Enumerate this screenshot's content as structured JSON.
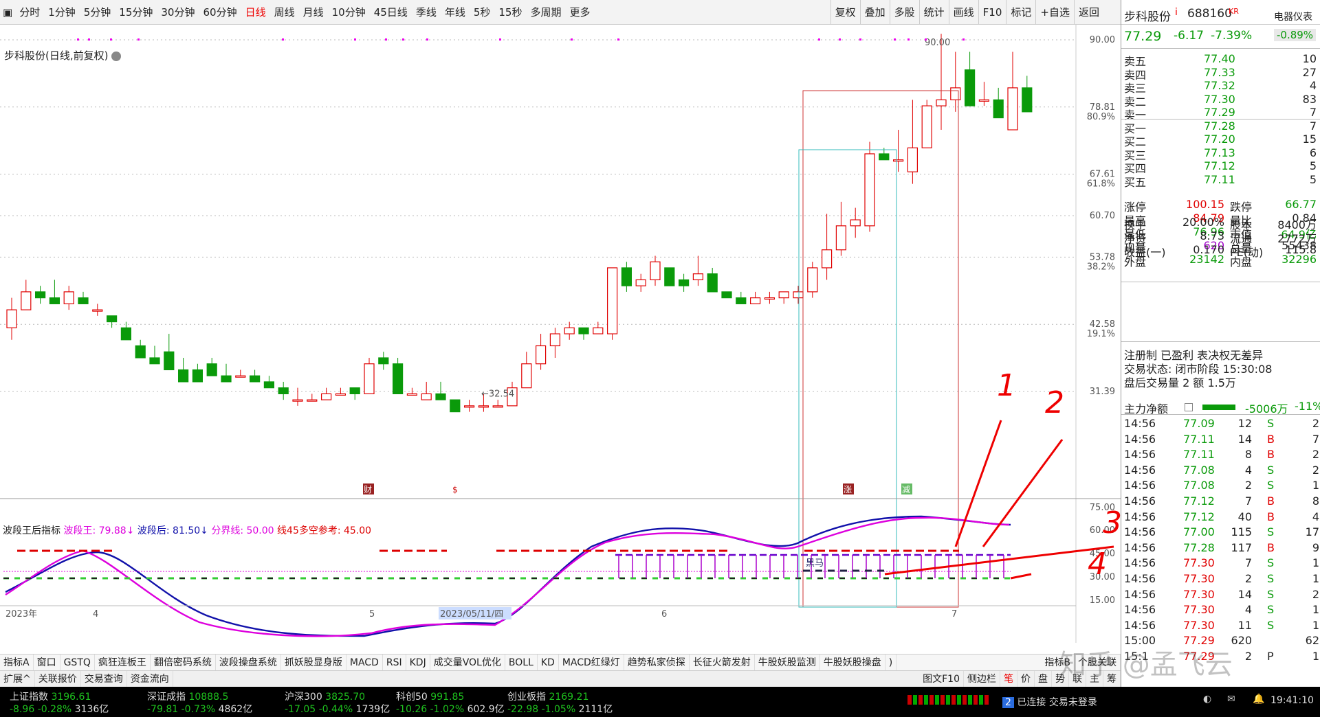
{
  "toolbar": {
    "left": [
      "分时",
      "1分钟",
      "5分钟",
      "15分钟",
      "30分钟",
      "60分钟",
      "日线",
      "周线",
      "月线",
      "10分钟",
      "45日线",
      "季线",
      "年线",
      "5秒",
      "15秒",
      "多周期",
      "更多"
    ],
    "active": "日线",
    "right": [
      "复权",
      "叠加",
      "多股",
      "统计",
      "画线",
      "F10",
      "标记",
      "+自选",
      "返回"
    ]
  },
  "chart": {
    "subtitle": "步科股份(日线,前复权)",
    "high_label": "90.00",
    "low_label": "32.54",
    "y_labels": [
      "90.00",
      "78.81",
      "80.9%",
      "67.61",
      "61.8%",
      "60.70",
      "53.78",
      "38.2%",
      "42.58",
      "19.1%",
      "31.39"
    ],
    "event_badges": [
      "财",
      "$",
      "涨",
      "减"
    ],
    "x_labels": [
      "2023年",
      "4",
      "5",
      "2023/05/11/四",
      "6",
      "7"
    ]
  },
  "chart_data": {
    "type": "candlestick",
    "ohlc": [
      [
        42,
        47,
        40,
        45
      ],
      [
        45,
        50,
        45,
        48
      ],
      [
        48,
        49,
        46,
        47
      ],
      [
        47,
        50,
        46,
        46
      ],
      [
        46,
        49,
        45,
        48
      ],
      [
        47,
        48,
        46,
        46
      ],
      [
        45,
        46,
        44,
        45
      ],
      [
        44,
        44,
        42,
        43
      ],
      [
        42,
        43,
        40,
        40
      ],
      [
        39,
        40,
        37,
        37
      ],
      [
        37,
        39,
        36,
        36
      ],
      [
        38,
        41,
        35,
        35
      ],
      [
        35,
        37,
        33,
        33
      ],
      [
        35,
        36,
        34,
        33
      ],
      [
        36,
        37,
        34,
        34
      ],
      [
        34,
        36,
        33,
        33
      ],
      [
        34,
        35,
        34,
        34
      ],
      [
        34,
        35,
        33,
        33
      ],
      [
        33,
        34,
        32,
        32
      ],
      [
        32,
        33,
        30,
        31
      ],
      [
        30,
        32,
        29,
        30
      ],
      [
        30,
        31,
        30,
        30
      ],
      [
        30,
        32,
        30,
        31
      ],
      [
        31,
        32,
        31,
        31
      ],
      [
        32,
        32,
        30,
        31
      ],
      [
        31,
        37,
        31,
        36
      ],
      [
        37,
        38,
        35,
        36
      ],
      [
        36,
        37,
        31,
        31
      ],
      [
        31,
        32,
        31,
        31
      ],
      [
        30,
        33,
        30,
        31
      ],
      [
        31,
        33,
        30,
        30
      ],
      [
        30,
        30,
        29,
        28
      ],
      [
        29,
        30,
        28,
        29
      ],
      [
        29,
        31,
        28,
        29
      ],
      [
        29,
        30,
        29,
        29
      ],
      [
        29,
        33,
        29,
        32
      ],
      [
        32,
        38,
        32,
        36
      ],
      [
        36,
        41,
        35,
        39
      ],
      [
        39,
        42,
        37,
        41
      ],
      [
        41,
        43,
        40,
        42
      ],
      [
        42,
        42,
        40,
        41
      ],
      [
        41,
        43,
        41,
        42
      ],
      [
        41,
        52,
        40,
        52
      ],
      [
        52,
        53,
        48,
        49
      ],
      [
        49,
        51,
        48,
        50
      ],
      [
        50,
        54,
        49,
        53
      ],
      [
        52,
        52,
        49,
        49
      ],
      [
        50,
        51,
        48,
        49
      ],
      [
        50,
        54,
        49,
        51
      ],
      [
        51,
        52,
        48,
        48
      ],
      [
        48,
        48,
        47,
        47
      ],
      [
        47,
        48,
        46,
        46
      ],
      [
        46,
        48,
        46,
        47
      ],
      [
        47,
        48,
        46,
        47
      ],
      [
        47,
        48,
        46,
        48
      ],
      [
        47,
        49,
        46,
        48
      ],
      [
        48,
        53,
        47,
        52
      ],
      [
        52,
        61,
        50,
        55
      ],
      [
        55,
        63,
        54,
        59
      ],
      [
        59,
        62,
        57,
        60
      ],
      [
        59,
        73,
        58,
        71
      ],
      [
        71,
        72,
        70,
        70
      ],
      [
        70,
        75,
        68,
        70
      ],
      [
        68,
        80,
        66,
        72
      ],
      [
        72,
        80,
        72,
        79
      ],
      [
        79,
        91,
        75,
        80
      ],
      [
        80,
        88,
        78,
        82
      ],
      [
        85,
        88,
        79,
        79
      ],
      [
        80,
        83,
        79,
        80
      ],
      [
        80,
        82,
        78,
        77
      ],
      [
        75,
        88,
        75,
        82
      ],
      [
        82,
        84,
        79,
        78
      ]
    ],
    "up_color": "#e00000",
    "down_color": "#0a9a0a"
  },
  "indicator": {
    "title": "波段王后指标",
    "l1": "波段王: 79.88",
    "l1d": "↓",
    "l2": "波段后: 81.50",
    "l2d": "↓",
    "l3": "分界线: 50.00",
    "l4": "线45多空参考: 45.00",
    "y_labels": [
      "75.00",
      "60.00",
      "45.00",
      "30.00",
      "15.00"
    ],
    "tag": "黑马"
  },
  "annotations": [
    "1",
    "2",
    "3",
    "4"
  ],
  "tabs1": [
    "指标A",
    "窗口",
    "GSTQ",
    "疯狂连板王",
    "翻倍密码系统",
    "波段操盘系统",
    "抓妖股显身版",
    "MACD",
    "RSI",
    "KDJ",
    "成交量VOL优化",
    "BOLL",
    "KD",
    "MACD红绿灯",
    "趋势私家侦探",
    "长征火箭发射",
    "牛股妖股监测",
    "牛股妖股操盘",
    ")",
    "指标B",
    "个股关联"
  ],
  "tabs2": [
    "扩展^",
    "关联报价",
    "交易查询",
    "资金流向",
    "图文F10",
    "侧边栏",
    "笔",
    "价",
    "盘",
    "势",
    "联",
    "主",
    "筹"
  ],
  "quote": {
    "name": "步科股份",
    "marker": "i",
    "code": "688160",
    "flag": "KR",
    "sector": "电器仪表",
    "price": "77.29",
    "change": "-6.17",
    "pct": "-7.39%",
    "sector_pct": "-0.89%"
  },
  "sell": [
    [
      "卖五",
      "77.40",
      "10"
    ],
    [
      "卖四",
      "77.33",
      "27"
    ],
    [
      "卖三",
      "77.32",
      "4"
    ],
    [
      "卖二",
      "77.30",
      "83"
    ],
    [
      "卖一",
      "77.29",
      "7"
    ]
  ],
  "buy": [
    [
      "买一",
      "77.28",
      "7"
    ],
    [
      "买二",
      "77.20",
      "15"
    ],
    [
      "买三",
      "77.13",
      "6"
    ],
    [
      "买四",
      "77.12",
      "5"
    ],
    [
      "买五",
      "77.11",
      "5"
    ]
  ],
  "stats": [
    [
      "涨停",
      "100.15",
      "跌停",
      "66.77"
    ],
    [
      "最高",
      "84.79",
      "量比",
      "0.84"
    ],
    [
      "最低",
      "76.96",
      "市值",
      "64.9亿"
    ],
    [
      "现量",
      "620",
      "总量",
      "55438"
    ],
    [
      "外盘",
      "23142",
      "内盘",
      "32296"
    ],
    [
      "换手",
      "20.00%",
      "股本",
      "8400万"
    ],
    [
      "净资",
      "8.73",
      "流通",
      "2772万"
    ],
    [
      "收益(一)",
      "0.170",
      "PE(动)",
      "115.8"
    ]
  ],
  "info": [
    "注册制 已盈利 表决权无差异",
    "交易状态: 闭市阶段 15:30:08",
    "盘后交易量 2 额 1.5万"
  ],
  "mainflow": {
    "label": "主力净额",
    "value": "-5006万",
    "pct": "-11%"
  },
  "ticks": [
    [
      "14:56",
      "77.09",
      "12",
      "S",
      "2"
    ],
    [
      "14:56",
      "77.11",
      "14",
      "B",
      "7"
    ],
    [
      "14:56",
      "77.11",
      "8",
      "B",
      "2"
    ],
    [
      "14:56",
      "77.08",
      "4",
      "S",
      "2"
    ],
    [
      "14:56",
      "77.08",
      "2",
      "S",
      "1"
    ],
    [
      "14:56",
      "77.12",
      "7",
      "B",
      "8"
    ],
    [
      "14:56",
      "77.12",
      "40",
      "B",
      "4"
    ],
    [
      "14:56",
      "77.00",
      "115",
      "S",
      "17"
    ],
    [
      "14:56",
      "77.28",
      "117",
      "B",
      "9"
    ],
    [
      "14:56",
      "77.30",
      "7",
      "S",
      "1"
    ],
    [
      "14:56",
      "77.30",
      "2",
      "S",
      "1"
    ],
    [
      "14:56",
      "77.30",
      "14",
      "S",
      "2"
    ],
    [
      "14:56",
      "77.30",
      "4",
      "S",
      "1"
    ],
    [
      "14:56",
      "77.30",
      "11",
      "S",
      "1"
    ],
    [
      "15:00",
      "77.29",
      "620",
      "",
      "62"
    ],
    [
      "15:1",
      "77.29",
      "2",
      "P",
      "1"
    ]
  ],
  "indices": [
    {
      "name": "上证指数",
      "val": "3196.61",
      "chg": "-8.96",
      "pct": "-0.28%",
      "amt": "3136亿"
    },
    {
      "name": "深证成指",
      "val": "10888.5",
      "chg": "-79.81",
      "pct": "-0.73%",
      "amt": "4862亿"
    },
    {
      "name": "沪深300",
      "val": "3825.70",
      "chg": "-17.05",
      "pct": "-0.44%",
      "amt": "1739亿"
    },
    {
      "name": "科创50",
      "val": "991.85",
      "chg": "-10.26",
      "pct": "-1.02%",
      "amt": "602.9亿"
    },
    {
      "name": "创业板指",
      "val": "2169.21",
      "chg": "-22.98",
      "pct": "-1.05%",
      "amt": "2111亿"
    }
  ],
  "status": {
    "conn": "已连接 交易未登录",
    "badge": "2",
    "time": "19:41:10"
  },
  "watermark": "知乎 @孟飞云"
}
